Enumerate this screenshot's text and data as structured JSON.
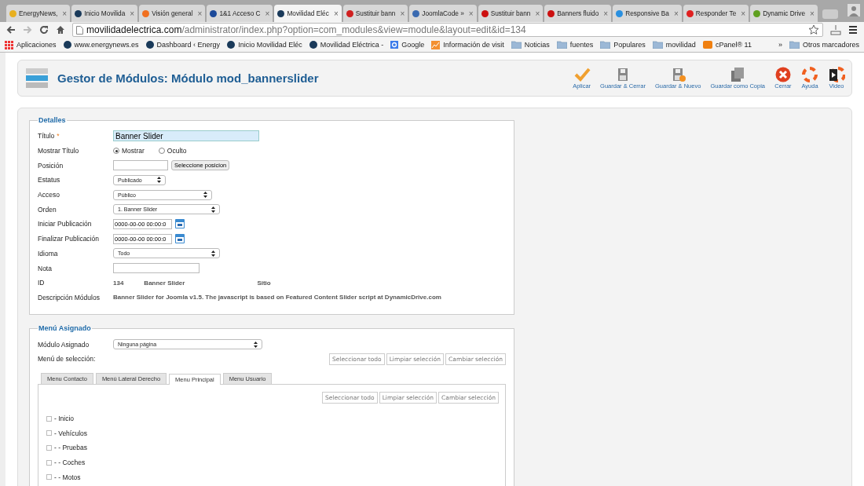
{
  "browser": {
    "tabs": [
      {
        "title": "EnergyNews,",
        "close": "×",
        "color": "#e8b020",
        "selected": false
      },
      {
        "title": "Inicio Movilida",
        "close": "×",
        "color": "#1a3a5a",
        "selected": false
      },
      {
        "title": "Visión general",
        "close": "×",
        "color": "#f07020",
        "selected": false
      },
      {
        "title": "1&1 Acceso C",
        "close": "×",
        "color": "#1c4a9a",
        "selected": false
      },
      {
        "title": "Movilidad Eléc",
        "close": "×",
        "color": "#1a3a5a",
        "selected": true
      },
      {
        "title": "Sustituir bann",
        "close": "×",
        "color": "#d02020",
        "selected": false
      },
      {
        "title": "JoomlaCode »",
        "close": "×",
        "color": "#3a6ab0",
        "selected": false
      },
      {
        "title": "Sustituir bann",
        "close": "×",
        "color": "#cc1010",
        "selected": false
      },
      {
        "title": "Banners fluido",
        "close": "×",
        "color": "#cc1010",
        "selected": false
      },
      {
        "title": "Responsive Ba",
        "close": "×",
        "color": "#2a90e0",
        "selected": false
      },
      {
        "title": "Responder Te",
        "close": "×",
        "color": "#e02020",
        "selected": false
      },
      {
        "title": "Dynamic Drive",
        "close": "×",
        "color": "#60a020",
        "selected": false
      }
    ],
    "url": {
      "host": "movilidadelectrica.com",
      "path": "/administrator/index.php?option=com_modules&view=module&layout=edit&id=134"
    },
    "bookmarks": [
      {
        "label": "Aplicaciones",
        "kind": "apps"
      },
      {
        "label": "www.energynews.es",
        "kind": "site"
      },
      {
        "label": "Dashboard ‹ Energy",
        "kind": "site"
      },
      {
        "label": "Inicio Movilidad Eléc",
        "kind": "site"
      },
      {
        "label": "Movilidad Eléctrica -",
        "kind": "site"
      },
      {
        "label": "Google",
        "kind": "google"
      },
      {
        "label": "Información de visit",
        "kind": "chart"
      },
      {
        "label": "Noticias",
        "kind": "folder"
      },
      {
        "label": "fuentes",
        "kind": "folder"
      },
      {
        "label": "Populares",
        "kind": "folder"
      },
      {
        "label": "movilidad",
        "kind": "folder"
      },
      {
        "label": "cPanel® 11",
        "kind": "cpanel"
      }
    ],
    "overflow": "»",
    "other_bookmarks": "Otros marcadores"
  },
  "header": {
    "title": "Gestor de Módulos: Módulo mod_bannerslider"
  },
  "toolbar": [
    {
      "label": "Aplicar",
      "kind": "apply"
    },
    {
      "label": "Guardar & Cerrar",
      "kind": "save"
    },
    {
      "label": "Guardar & Nuevo",
      "kind": "savenew"
    },
    {
      "label": "Guardar como Copia",
      "kind": "copy"
    },
    {
      "label": "Cerrar",
      "kind": "close"
    },
    {
      "label": "Ayuda",
      "kind": "help"
    },
    {
      "label": "Video",
      "kind": "video"
    }
  ],
  "details": {
    "legend": "Detalles",
    "fields": [
      {
        "label": "Título",
        "required_mark": "*",
        "kind": "title",
        "value": "Banner Slider"
      },
      {
        "label": "Mostrar Título",
        "kind": "radio",
        "options": [
          {
            "label": "Mostrar",
            "selected": true
          },
          {
            "label": "Oculto",
            "selected": false
          }
        ]
      },
      {
        "label": "Posición",
        "kind": "position",
        "button": "Seleccione posicion"
      },
      {
        "label": "Estatus",
        "kind": "select",
        "value": "Publicado"
      },
      {
        "label": "Acceso",
        "kind": "select",
        "value": "Público"
      },
      {
        "label": "Orden",
        "kind": "select",
        "value": "1. Banner Slider"
      },
      {
        "label": "Iniciar Publicación",
        "kind": "date",
        "value": "0000-00-00 00:00:0"
      },
      {
        "label": "Finalizar Publicación",
        "kind": "date",
        "value": "0000-00-00 00:00:0"
      },
      {
        "label": "Idioma",
        "kind": "select",
        "value": "Todo"
      },
      {
        "label": "Nota",
        "kind": "text"
      },
      {
        "label": "ID",
        "kind": "info",
        "parts": [
          "134",
          "Banner Slider",
          "Sitio"
        ]
      },
      {
        "label": "Descripción Módulos",
        "kind": "desc",
        "value": "Banner Slider for Joomla v1.5. The javascript is based on Featured Content Slider script at DynamicDrive.com"
      }
    ]
  },
  "menu": {
    "legend": "Menú Asignado",
    "assigned_label": "Módulo Asignado",
    "assigned_value": "Ninguna página",
    "selection_label": "Menú de selección:",
    "buttons": [
      "Seleccionar todo",
      "Limpiar selección",
      "Cambiar selección"
    ],
    "tabs": [
      {
        "label": "Menu Contacto",
        "selected": false
      },
      {
        "label": "Menú Lateral Derecho",
        "selected": false
      },
      {
        "label": "Menu Principal",
        "selected": true
      },
      {
        "label": "Menu Usuario",
        "selected": false
      }
    ],
    "inner_buttons": [
      "Seleccionar todo",
      "Limpiar selección",
      "Cambiar selección"
    ],
    "items": [
      {
        "label": "- Inicio",
        "checked": false
      },
      {
        "label": "- Vehículos",
        "checked": false
      },
      {
        "label": "- - Pruebas",
        "checked": false
      },
      {
        "label": "- - Coches",
        "checked": false
      },
      {
        "label": "- - Motos",
        "checked": false
      }
    ]
  }
}
